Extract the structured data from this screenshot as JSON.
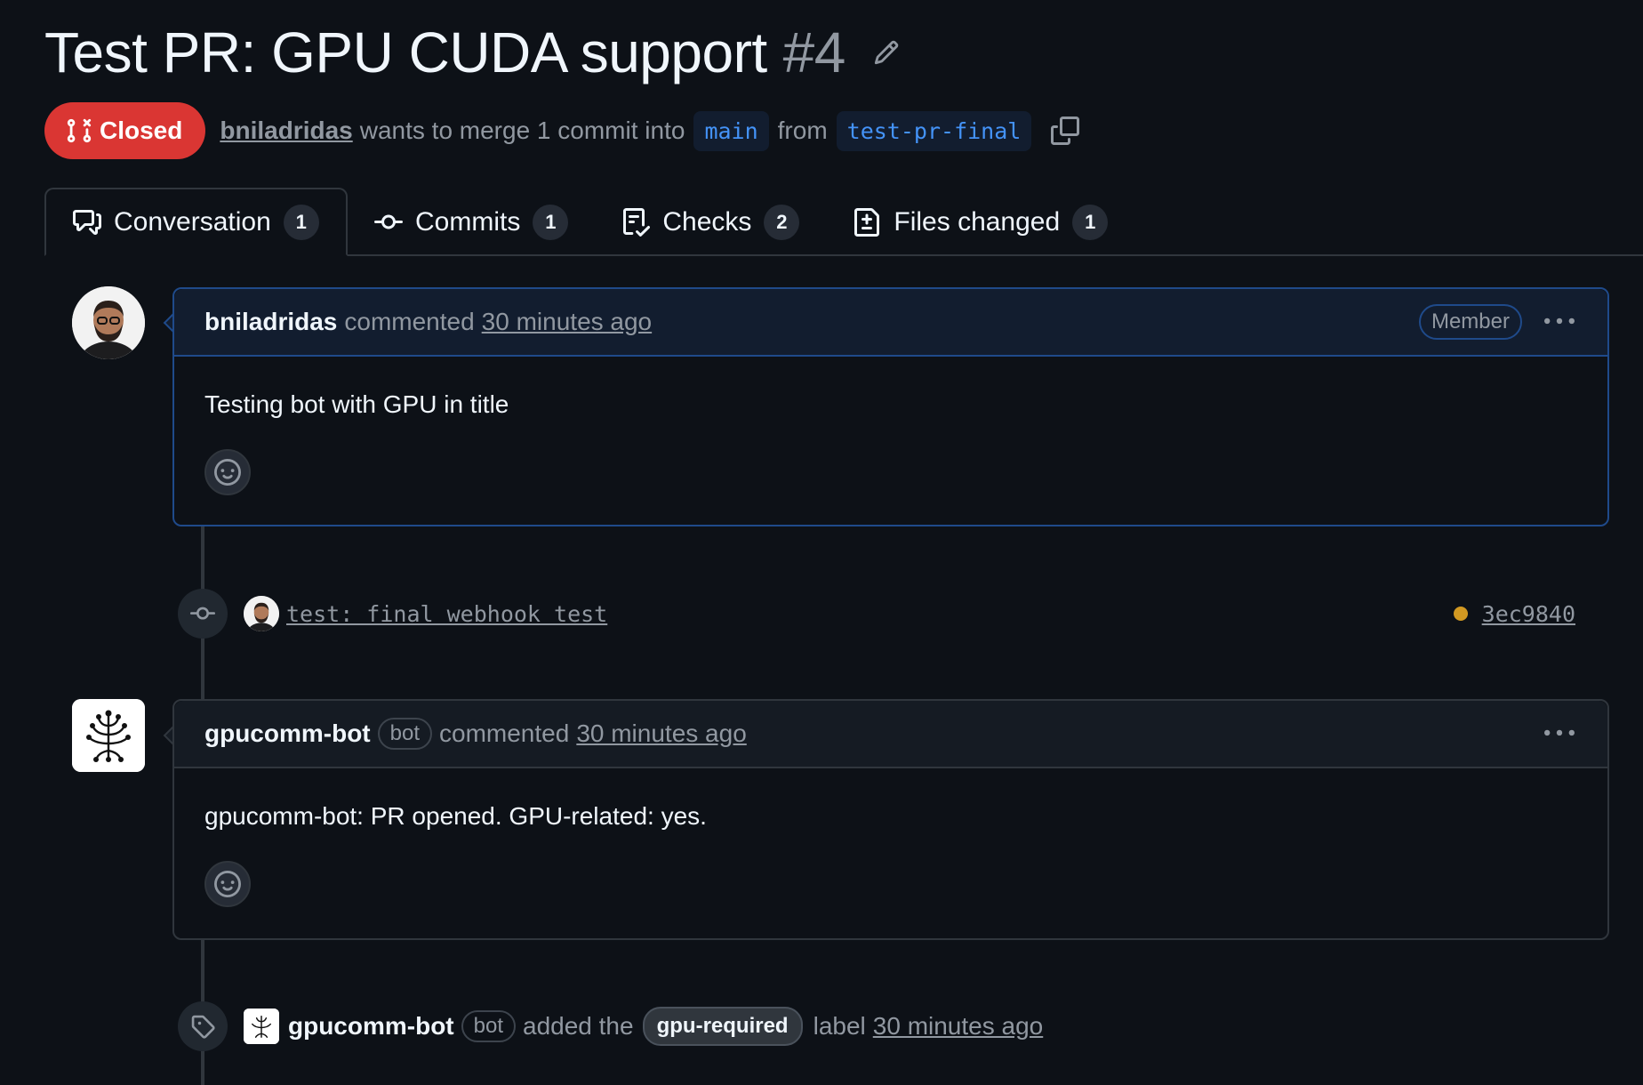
{
  "header": {
    "title": "Test PR: GPU CUDA support",
    "number": "#4",
    "state": "Closed",
    "author": "bniladridas",
    "merge_text": "wants to merge 1 commit into",
    "base_branch": "main",
    "from_text": "from",
    "head_branch": "test-pr-final"
  },
  "tabs": [
    {
      "label": "Conversation",
      "count": "1",
      "icon": "comment-discussion-icon",
      "active": true
    },
    {
      "label": "Commits",
      "count": "1",
      "icon": "git-commit-icon"
    },
    {
      "label": "Checks",
      "count": "2",
      "icon": "checklist-icon"
    },
    {
      "label": "Files changed",
      "count": "1",
      "icon": "file-diff-icon"
    }
  ],
  "timeline": {
    "comment1": {
      "author": "bniladridas",
      "action": "commented",
      "time": "30 minutes ago",
      "role_badge": "Member",
      "body": "Testing bot with GPU in title"
    },
    "commit": {
      "message": "test: final webhook test",
      "sha": "3ec9840",
      "status_color": "#d29922"
    },
    "comment2": {
      "author": "gpucomm-bot",
      "bot_badge": "bot",
      "action": "commented",
      "time": "30 minutes ago",
      "body": "gpucomm-bot: PR opened. GPU-related: yes."
    },
    "label_event": {
      "author": "gpucomm-bot",
      "bot_badge": "bot",
      "action": "added the",
      "label": "gpu-required",
      "suffix": "label",
      "time": "30 minutes ago"
    }
  },
  "colors": {
    "background": "#0d1117",
    "closed_red": "#da3633",
    "branch_blue": "#4493f8",
    "muted": "#9198a1"
  }
}
